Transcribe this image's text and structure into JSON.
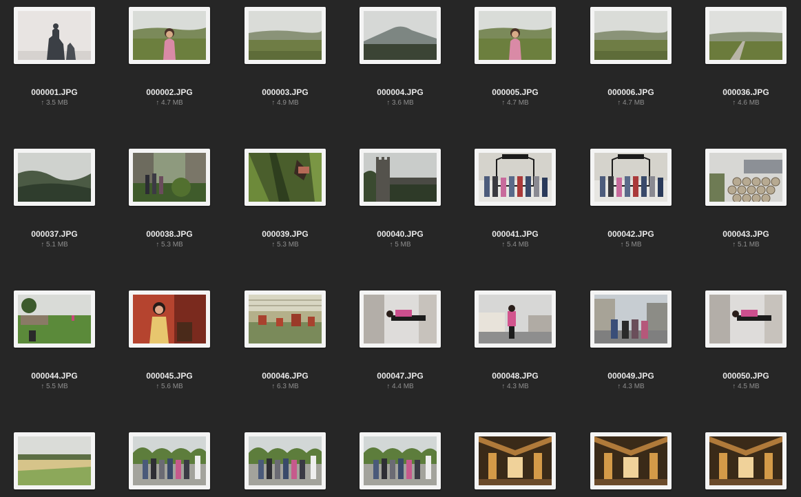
{
  "files": [
    {
      "name": "000001.JPG",
      "size": "↑ 3.5 MB",
      "scene": "statue"
    },
    {
      "name": "000002.JPG",
      "size": "↑ 4.7 MB",
      "scene": "portrait-moor"
    },
    {
      "name": "000003.JPG",
      "size": "↑ 4.9 MB",
      "scene": "moor"
    },
    {
      "name": "000004.JPG",
      "size": "↑ 3.6 MB",
      "scene": "mountain"
    },
    {
      "name": "000005.JPG",
      "size": "↑ 4.7 MB",
      "scene": "portrait-moor"
    },
    {
      "name": "000006.JPG",
      "size": "↑ 4.7 MB",
      "scene": "moor"
    },
    {
      "name": "000036.JPG",
      "size": "↑ 4.6 MB",
      "scene": "moor-road"
    },
    {
      "name": "000037.JPG",
      "size": "↑ 5.1 MB",
      "scene": "hills"
    },
    {
      "name": "000038.JPG",
      "size": "↑ 5.3 MB",
      "scene": "garden-group"
    },
    {
      "name": "000039.JPG",
      "size": "↑ 5.3 MB",
      "scene": "forest"
    },
    {
      "name": "000040.JPG",
      "size": "↑ 5 MB",
      "scene": "castle"
    },
    {
      "name": "000041.JPG",
      "size": "↑ 5.4 MB",
      "scene": "gate-group"
    },
    {
      "name": "000042.JPG",
      "size": "↑ 5 MB",
      "scene": "gate-group"
    },
    {
      "name": "000043.JPG",
      "size": "↑ 5.1 MB",
      "scene": "barrels"
    },
    {
      "name": "000044.JPG",
      "size": "↑ 5.5 MB",
      "scene": "field-barrels"
    },
    {
      "name": "000045.JPG",
      "size": "↑ 5.6 MB",
      "scene": "red-room"
    },
    {
      "name": "000046.JPG",
      "size": "↑ 6.3 MB",
      "scene": "factory"
    },
    {
      "name": "000047.JPG",
      "size": "↑ 4.4 MB",
      "scene": "rotated-street"
    },
    {
      "name": "000048.JPG",
      "size": "↑ 4.3 MB",
      "scene": "street-portrait"
    },
    {
      "name": "000049.JPG",
      "size": "↑ 4.3 MB",
      "scene": "street-group"
    },
    {
      "name": "000050.JPG",
      "size": "↑ 4.5 MB",
      "scene": "rotated-street"
    },
    {
      "name": "",
      "size": "",
      "scene": "field"
    },
    {
      "name": "",
      "size": "",
      "scene": "distillery-group"
    },
    {
      "name": "",
      "size": "",
      "scene": "distillery-group"
    },
    {
      "name": "",
      "size": "",
      "scene": "distillery-group"
    },
    {
      "name": "",
      "size": "",
      "scene": "stills"
    },
    {
      "name": "",
      "size": "",
      "scene": "stills"
    },
    {
      "name": "",
      "size": "",
      "scene": "stills"
    }
  ]
}
